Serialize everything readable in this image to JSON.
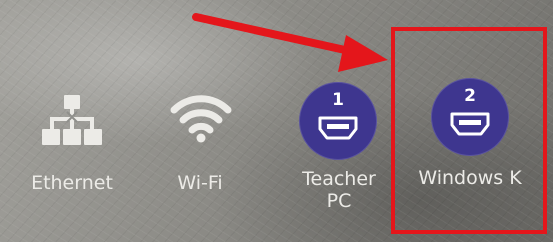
{
  "inputs": [
    {
      "label": "Ethernet",
      "icon": "network-icon"
    },
    {
      "label": "Wi-Fi",
      "icon": "wifi-icon"
    },
    {
      "label": "Teacher\nPC",
      "icon": "hdmi-icon",
      "number": "1"
    },
    {
      "label": "Windows K",
      "icon": "hdmi-icon",
      "number": "2"
    }
  ],
  "colors": {
    "hdmi_circle": "#3e368f",
    "annotation": "#e4161b",
    "label_text": "#ecebe7"
  }
}
